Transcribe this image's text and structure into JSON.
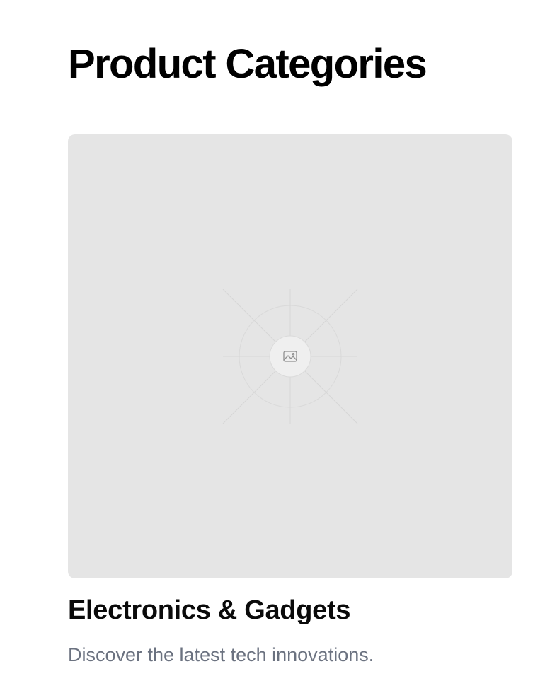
{
  "page": {
    "title": "Product Categories"
  },
  "categories": [
    {
      "image_icon": "image-placeholder-icon",
      "title": "Electronics & Gadgets",
      "description": "Discover the latest tech innovations."
    }
  ],
  "colors": {
    "title_text": "#000000",
    "description_text": "#6b7280",
    "placeholder_bg": "#e5e5e5"
  }
}
